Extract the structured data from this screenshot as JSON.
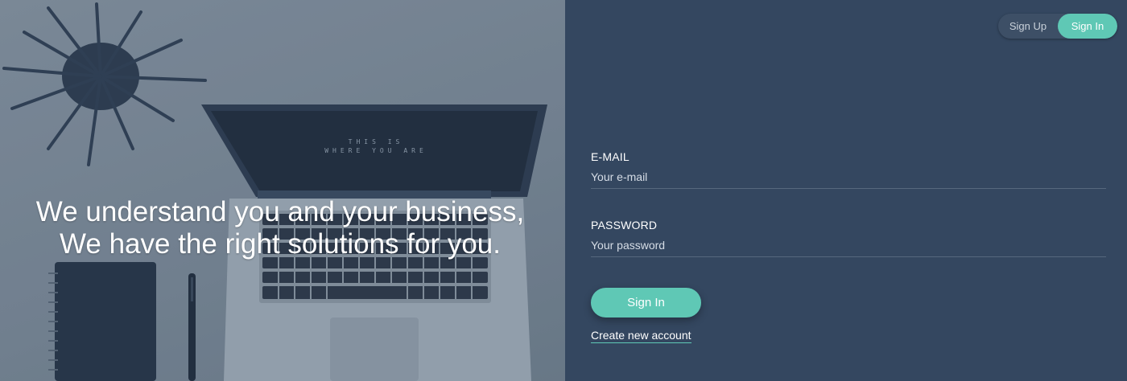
{
  "hero": {
    "tagline_line1": "We understand you and your business,",
    "tagline_line2": "We have the right solutions for you.",
    "screen_line1": "THIS IS",
    "screen_line2": "WHERE YOU ARE"
  },
  "switcher": {
    "signup_label": "Sign Up",
    "signin_label": "Sign In",
    "active": "Sign In"
  },
  "form": {
    "email": {
      "label": "E-MAIL",
      "placeholder": "Your e-mail",
      "value": ""
    },
    "password": {
      "label": "PASSWORD",
      "placeholder": "Your password",
      "value": ""
    },
    "submit_label": "Sign In",
    "create_account_label": "Create new account"
  },
  "colors": {
    "accent": "#5fc8b5",
    "panel_bg": "#344760"
  }
}
